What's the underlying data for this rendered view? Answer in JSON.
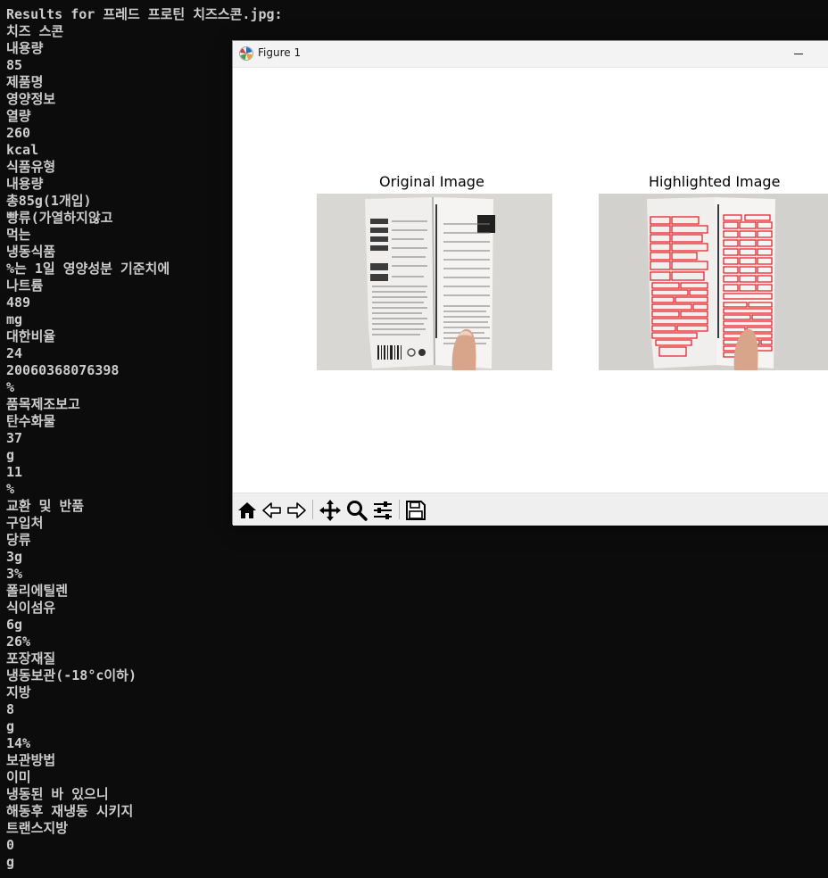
{
  "terminal": {
    "lines": [
      "Results for 프레드 프로틴 치즈스콘.jpg:",
      "치즈 스콘",
      "내용량",
      "85",
      "제품명",
      "영양정보",
      "열량",
      "260",
      "kcal",
      "식품유형",
      "내용량",
      "총85g(1개입)",
      "빵류(가열하지않고",
      "먹는",
      "냉동식품",
      "%는 1일 영양성분 기준치에",
      "나트륨",
      "489",
      "mg",
      "대한비율",
      "24",
      "20060368076398",
      "%",
      "품목제조보고",
      "탄수화물",
      "37",
      "g",
      "11",
      "%",
      "교환 및 반품",
      "구입처",
      "당류",
      "3g",
      "3%",
      "폴리에틸렌",
      "식이섬유",
      "6g",
      "26%",
      "포장재질",
      "냉동보관(-18°c이하)",
      "지방",
      "8",
      "g",
      "14%",
      "보관방법",
      "이미",
      "냉동된 바 있으니",
      "해동후 재냉동 시키지",
      "트랜스지방",
      "0",
      "g"
    ]
  },
  "figure_window": {
    "title": "Figure 1",
    "left_axes_title": "Original Image",
    "right_axes_title": "Highlighted Image",
    "colors": {
      "highlight": "#e8141e",
      "toolbar_bg": "#efefef",
      "titlebar_bg": "#f3f3f3"
    },
    "toolbar_icons": [
      "home-icon",
      "back-icon",
      "forward-icon",
      "pan-icon",
      "zoom-icon",
      "configure-subplots-icon",
      "save-icon"
    ]
  }
}
